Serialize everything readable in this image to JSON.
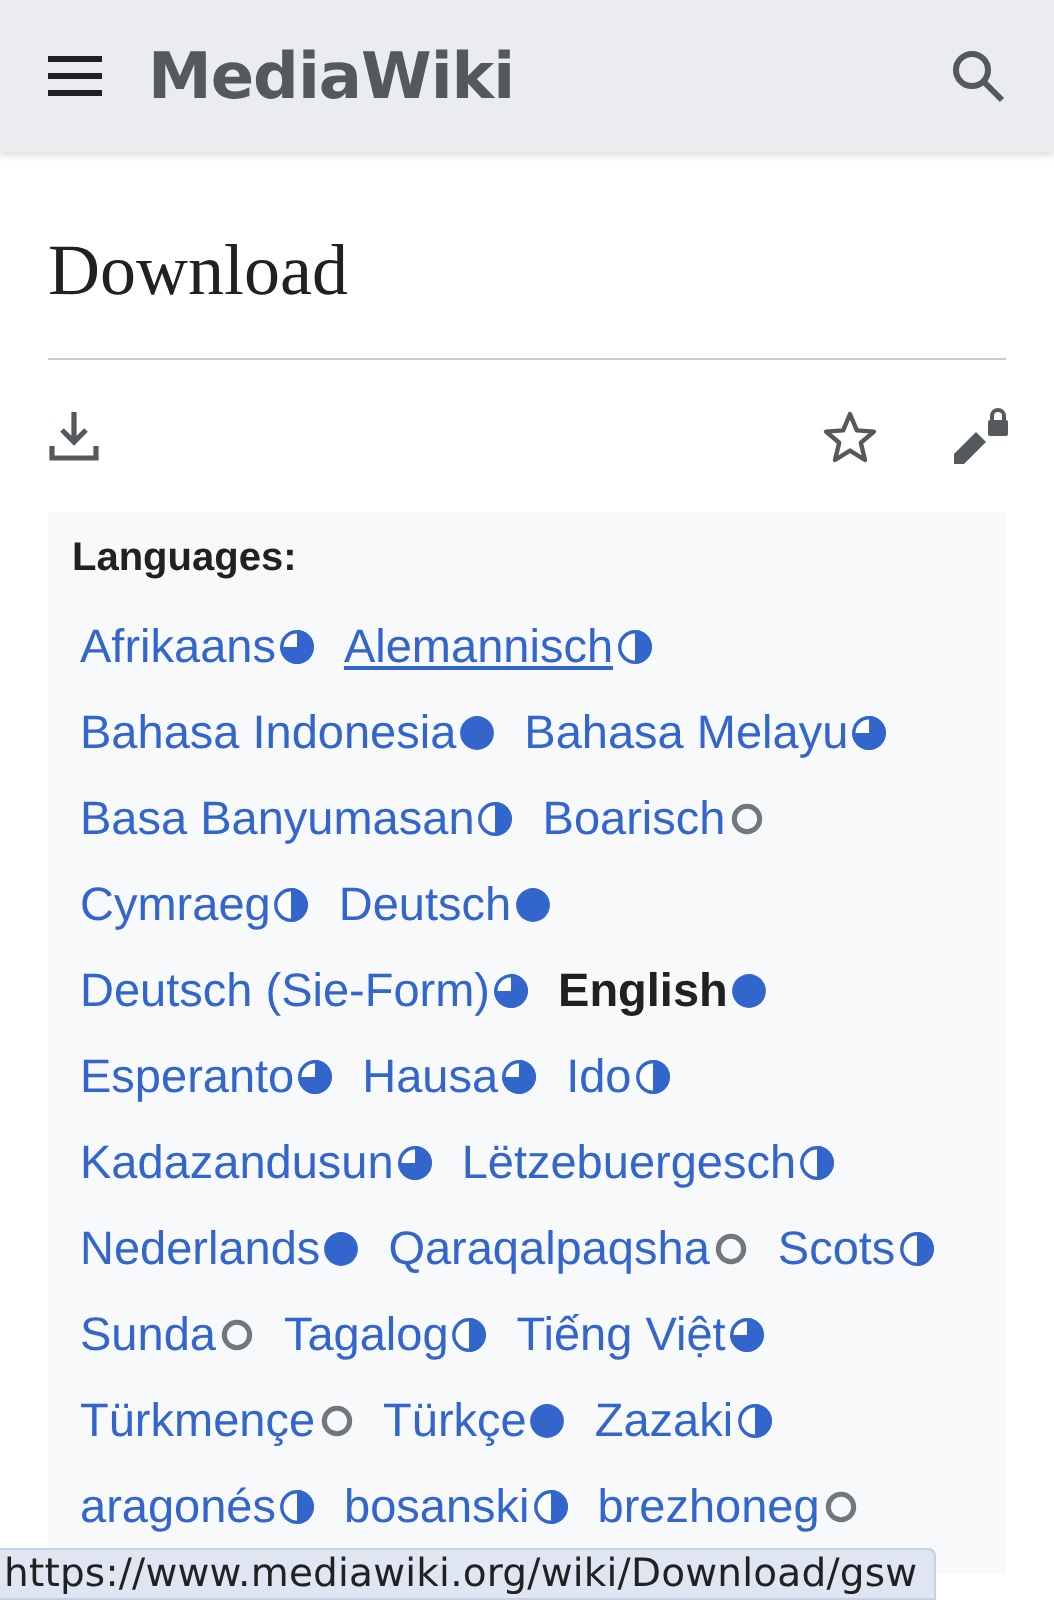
{
  "header": {
    "site_name": "MediaWiki"
  },
  "page": {
    "title": "Download"
  },
  "languages": {
    "heading": "Languages:",
    "items": [
      {
        "name": "Afrikaans",
        "kind": "most",
        "selected": false,
        "hovered": false
      },
      {
        "name": "Alemannisch",
        "kind": "half",
        "selected": false,
        "hovered": true
      },
      {
        "name": "Bahasa Indonesia",
        "kind": "complete",
        "selected": false,
        "hovered": false
      },
      {
        "name": "Bahasa Melayu",
        "kind": "most",
        "selected": false,
        "hovered": false
      },
      {
        "name": "Basa Banyumasan",
        "kind": "half",
        "selected": false,
        "hovered": false
      },
      {
        "name": "Boarisch",
        "kind": "none",
        "selected": false,
        "hovered": false
      },
      {
        "name": "Cymraeg",
        "kind": "half",
        "selected": false,
        "hovered": false
      },
      {
        "name": "Deutsch",
        "kind": "complete",
        "selected": false,
        "hovered": false
      },
      {
        "name": "Deutsch (Sie-Form)",
        "kind": "most",
        "selected": false,
        "hovered": false
      },
      {
        "name": "English",
        "kind": "complete",
        "selected": true,
        "hovered": false
      },
      {
        "name": "Esperanto",
        "kind": "most",
        "selected": false,
        "hovered": false
      },
      {
        "name": "Hausa",
        "kind": "most",
        "selected": false,
        "hovered": false
      },
      {
        "name": "Ido",
        "kind": "half",
        "selected": false,
        "hovered": false
      },
      {
        "name": "Kadazandusun",
        "kind": "most",
        "selected": false,
        "hovered": false
      },
      {
        "name": "Lëtzebuergesch",
        "kind": "half",
        "selected": false,
        "hovered": false
      },
      {
        "name": "Nederlands",
        "kind": "complete",
        "selected": false,
        "hovered": false
      },
      {
        "name": "Qaraqalpaqsha",
        "kind": "none",
        "selected": false,
        "hovered": false
      },
      {
        "name": "Scots",
        "kind": "half",
        "selected": false,
        "hovered": false
      },
      {
        "name": "Sunda",
        "kind": "none",
        "selected": false,
        "hovered": false
      },
      {
        "name": "Tagalog",
        "kind": "half",
        "selected": false,
        "hovered": false
      },
      {
        "name": "Tiếng Việt",
        "kind": "most",
        "selected": false,
        "hovered": false
      },
      {
        "name": "Türkmençe",
        "kind": "none",
        "selected": false,
        "hovered": false
      },
      {
        "name": "Türkçe",
        "kind": "complete",
        "selected": false,
        "hovered": false
      },
      {
        "name": "Zazaki",
        "kind": "half",
        "selected": false,
        "hovered": false
      },
      {
        "name": "aragonés",
        "kind": "half",
        "selected": false,
        "hovered": false
      },
      {
        "name": "bosanski",
        "kind": "half",
        "selected": false,
        "hovered": false
      },
      {
        "name": "brezhoneg",
        "kind": "none",
        "selected": false,
        "hovered": false
      }
    ]
  },
  "status_bar": {
    "url": "https://www.mediawiki.org/wiki/Download/gsw"
  }
}
